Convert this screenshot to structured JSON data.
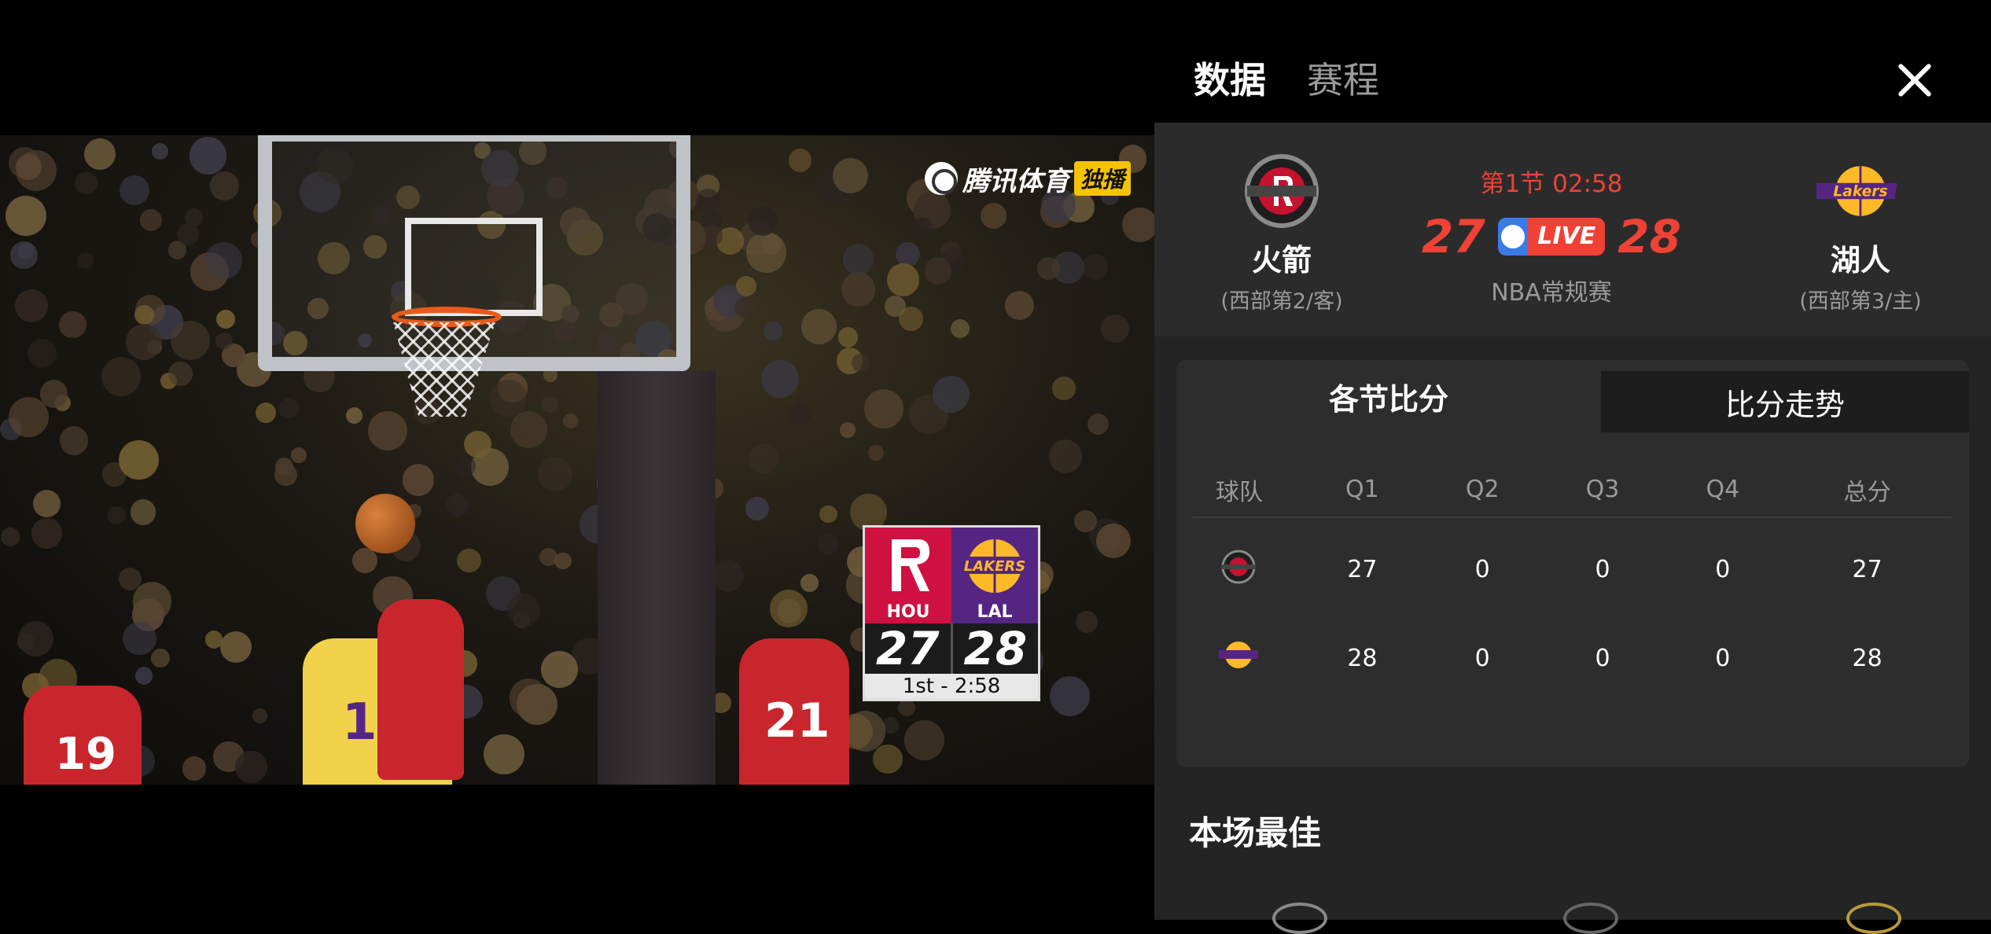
{
  "video": {
    "watermark_brand": "腾讯体育",
    "watermark_badge": "独播",
    "scorebug": {
      "home_abbr": "HOU",
      "away_abbr": "LAL",
      "home_score": "27",
      "away_score": "28",
      "clock": "1st - 2:58",
      "home_color": "#ce1141",
      "away_color": "#552583"
    },
    "jerseys": {
      "left": "19",
      "center": "17",
      "right": "21"
    }
  },
  "panel": {
    "tabs": {
      "data": "数据",
      "schedule": "赛程"
    },
    "match": {
      "home": {
        "name": "火箭",
        "rank": "(西部第2/客)"
      },
      "away": {
        "name": "湖人",
        "rank": "(西部第3/主)"
      },
      "period": "第1节 02:58",
      "home_score": "27",
      "away_score": "28",
      "live_label": "LIVE",
      "league": "NBA常规赛"
    },
    "score_tabs": {
      "active": "各节比分",
      "inactive": "比分走势"
    },
    "quarter_table": {
      "headers": [
        "球队",
        "Q1",
        "Q2",
        "Q3",
        "Q4",
        "总分"
      ],
      "rows": [
        {
          "team_icon": "rockets-logo-icon",
          "values": [
            "27",
            "0",
            "0",
            "0",
            "27"
          ]
        },
        {
          "team_icon": "lakers-logo-icon",
          "values": [
            "28",
            "0",
            "0",
            "0",
            "28"
          ]
        }
      ]
    },
    "best_title": "本场最佳"
  },
  "colors": {
    "accent_red": "#ef4136",
    "live_blue": "#3b7be8",
    "panel_bg": "#242424"
  }
}
